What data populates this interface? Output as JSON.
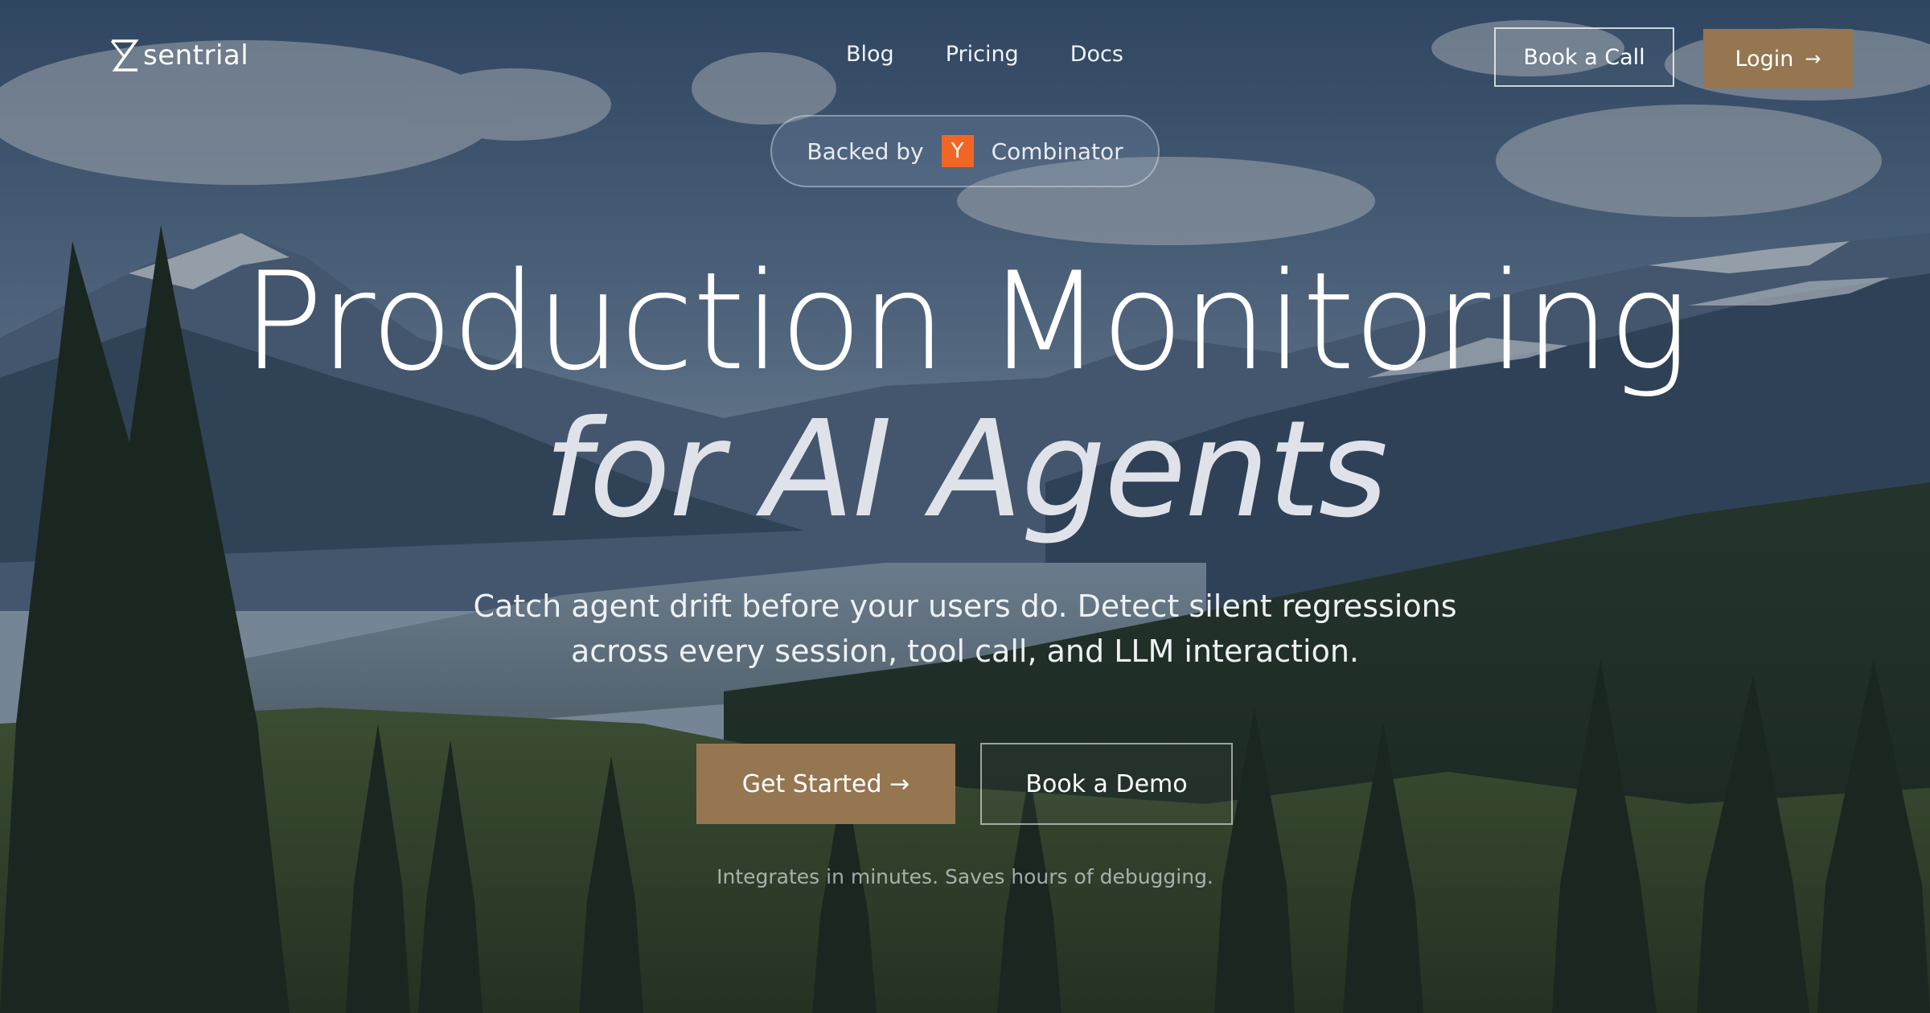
{
  "brand": {
    "name": "sentrial"
  },
  "nav": {
    "links": [
      "Blog",
      "Pricing",
      "Docs"
    ],
    "book_call_label": "Book a Call",
    "login_label": "Login",
    "login_icon": "arrow-right-icon"
  },
  "badge": {
    "prefix": "Backed by",
    "yc_letter": "Y",
    "suffix": "Combinator",
    "yc_color": "#f26625"
  },
  "hero": {
    "headline_line1": "Production Monitoring",
    "headline_line2": "for AI Agents",
    "subtext_line1": "Catch agent drift before your users do. Detect silent regressions",
    "subtext_line2": "across every session, tool call, and LLM interaction."
  },
  "cta": {
    "primary_label": "Get Started →",
    "secondary_label": "Book a Demo"
  },
  "footnote": "Integrates in minutes. Saves hours of debugging.",
  "colors": {
    "accent": "#957651",
    "text": "#ffffff"
  }
}
